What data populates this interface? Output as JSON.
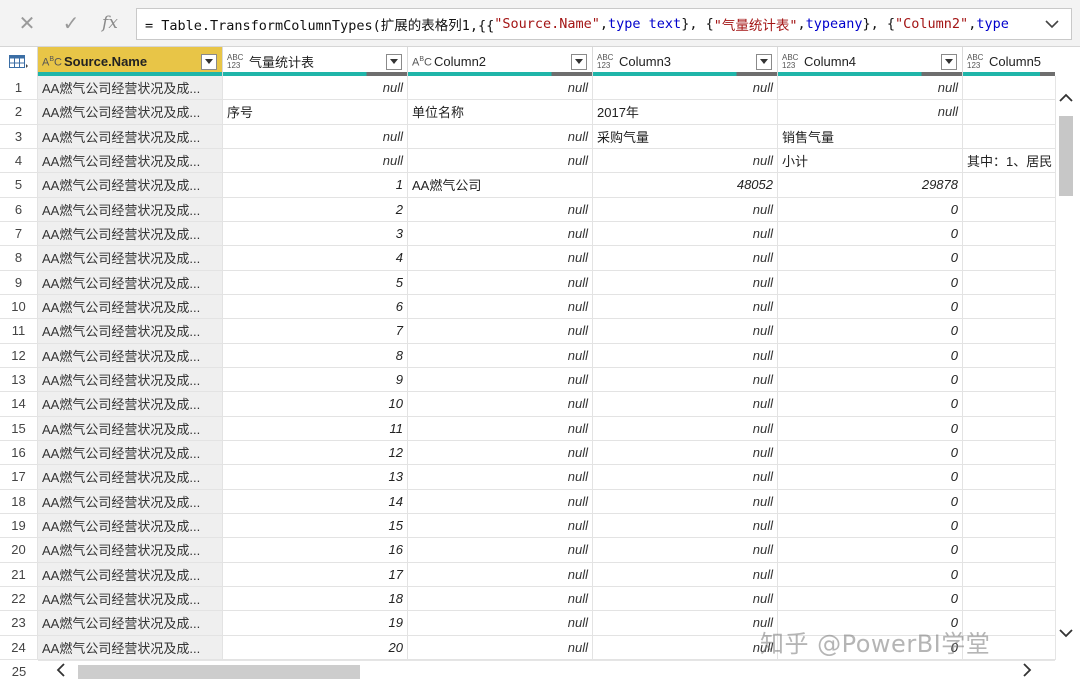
{
  "formula": {
    "cancel_icon": "close-icon",
    "commit_icon": "check-icon",
    "fx_label": "fx",
    "prefix": "= Table.TransformColumnTypes(扩展的表格列1,{{",
    "s1": "\"Source.Name\"",
    "sep1": ", ",
    "t1": "type text",
    "sep2": "}, {",
    "s2": "\"气量统计表\"",
    "sep3": ", ",
    "t2a": "type",
    "t2b": " any",
    "sep4": "}, {",
    "s3": "\"Column2\"",
    "sep5": ", ",
    "t3": "type"
  },
  "columns": [
    {
      "label": "Source.Name",
      "type": "ABC",
      "selected": true
    },
    {
      "label": "气量统计表",
      "type": "ABC123"
    },
    {
      "label": "Column2",
      "type": "ABC"
    },
    {
      "label": "Column3",
      "type": "ABC123"
    },
    {
      "label": "Column4",
      "type": "ABC123"
    },
    {
      "label": "Column5",
      "type": "ABC123"
    }
  ],
  "rows": [
    {
      "n": "1",
      "c": [
        "AA燃气公司经营状况及成...",
        "null",
        "null",
        "null",
        "null",
        ""
      ]
    },
    {
      "n": "2",
      "c": [
        "AA燃气公司经营状况及成...",
        "序号",
        "单位名称",
        "2017年",
        "null",
        ""
      ]
    },
    {
      "n": "3",
      "c": [
        "AA燃气公司经营状况及成...",
        "null",
        "null",
        "采购气量",
        "销售气量",
        ""
      ]
    },
    {
      "n": "4",
      "c": [
        "AA燃气公司经营状况及成...",
        "null",
        "null",
        "null",
        "小计",
        "其中：1、居民"
      ]
    },
    {
      "n": "5",
      "c": [
        "AA燃气公司经营状况及成...",
        "1",
        "AA燃气公司",
        "48052",
        "29878",
        ""
      ]
    },
    {
      "n": "6",
      "c": [
        "AA燃气公司经营状况及成...",
        "2",
        "null",
        "null",
        "0",
        ""
      ]
    },
    {
      "n": "7",
      "c": [
        "AA燃气公司经营状况及成...",
        "3",
        "null",
        "null",
        "0",
        ""
      ]
    },
    {
      "n": "8",
      "c": [
        "AA燃气公司经营状况及成...",
        "4",
        "null",
        "null",
        "0",
        ""
      ]
    },
    {
      "n": "9",
      "c": [
        "AA燃气公司经营状况及成...",
        "5",
        "null",
        "null",
        "0",
        ""
      ]
    },
    {
      "n": "10",
      "c": [
        "AA燃气公司经营状况及成...",
        "6",
        "null",
        "null",
        "0",
        ""
      ]
    },
    {
      "n": "11",
      "c": [
        "AA燃气公司经营状况及成...",
        "7",
        "null",
        "null",
        "0",
        ""
      ]
    },
    {
      "n": "12",
      "c": [
        "AA燃气公司经营状况及成...",
        "8",
        "null",
        "null",
        "0",
        ""
      ]
    },
    {
      "n": "13",
      "c": [
        "AA燃气公司经营状况及成...",
        "9",
        "null",
        "null",
        "0",
        ""
      ]
    },
    {
      "n": "14",
      "c": [
        "AA燃气公司经营状况及成...",
        "10",
        "null",
        "null",
        "0",
        ""
      ]
    },
    {
      "n": "15",
      "c": [
        "AA燃气公司经营状况及成...",
        "11",
        "null",
        "null",
        "0",
        ""
      ]
    },
    {
      "n": "16",
      "c": [
        "AA燃气公司经营状况及成...",
        "12",
        "null",
        "null",
        "0",
        ""
      ]
    },
    {
      "n": "17",
      "c": [
        "AA燃气公司经营状况及成...",
        "13",
        "null",
        "null",
        "0",
        ""
      ]
    },
    {
      "n": "18",
      "c": [
        "AA燃气公司经营状况及成...",
        "14",
        "null",
        "null",
        "0",
        ""
      ]
    },
    {
      "n": "19",
      "c": [
        "AA燃气公司经营状况及成...",
        "15",
        "null",
        "null",
        "0",
        ""
      ]
    },
    {
      "n": "20",
      "c": [
        "AA燃气公司经营状况及成...",
        "16",
        "null",
        "null",
        "0",
        ""
      ]
    },
    {
      "n": "21",
      "c": [
        "AA燃气公司经营状况及成...",
        "17",
        "null",
        "null",
        "0",
        ""
      ]
    },
    {
      "n": "22",
      "c": [
        "AA燃气公司经营状况及成...",
        "18",
        "null",
        "null",
        "0",
        ""
      ]
    },
    {
      "n": "23",
      "c": [
        "AA燃气公司经营状况及成...",
        "19",
        "null",
        "null",
        "0",
        ""
      ]
    },
    {
      "n": "24",
      "c": [
        "AA燃气公司经营状况及成...",
        "20",
        "null",
        "null",
        "0",
        ""
      ]
    }
  ],
  "footer_row_number": "25",
  "watermark": "知乎 @PowerBI学堂",
  "colors": {
    "selected_header": "#e8c547",
    "quality_bar": "#1fb5a9",
    "quality_bar_grey": "#6e6e6e"
  }
}
